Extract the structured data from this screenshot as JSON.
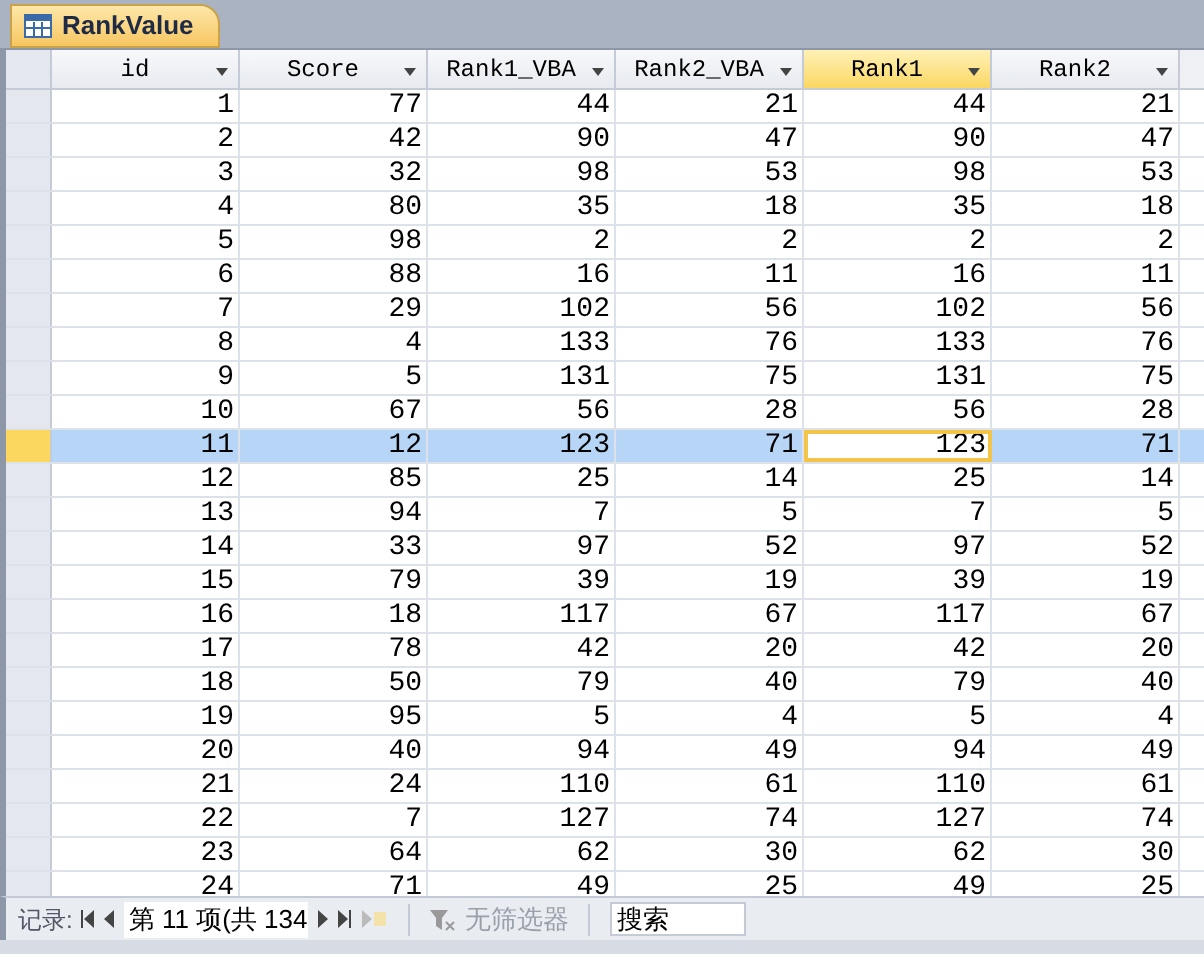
{
  "tab": {
    "title": "RankValue"
  },
  "columns": [
    {
      "label": "id",
      "selected": false
    },
    {
      "label": "Score",
      "selected": false
    },
    {
      "label": "Rank1_VBA",
      "selected": false
    },
    {
      "label": "Rank2_VBA",
      "selected": false
    },
    {
      "label": "Rank1",
      "selected": true
    },
    {
      "label": "Rank2",
      "selected": false
    }
  ],
  "rows": [
    {
      "cells": [
        "1",
        "77",
        "44",
        "21",
        "44",
        "21"
      ],
      "selected": false
    },
    {
      "cells": [
        "2",
        "42",
        "90",
        "47",
        "90",
        "47"
      ],
      "selected": false
    },
    {
      "cells": [
        "3",
        "32",
        "98",
        "53",
        "98",
        "53"
      ],
      "selected": false
    },
    {
      "cells": [
        "4",
        "80",
        "35",
        "18",
        "35",
        "18"
      ],
      "selected": false
    },
    {
      "cells": [
        "5",
        "98",
        "2",
        "2",
        "2",
        "2"
      ],
      "selected": false
    },
    {
      "cells": [
        "6",
        "88",
        "16",
        "11",
        "16",
        "11"
      ],
      "selected": false
    },
    {
      "cells": [
        "7",
        "29",
        "102",
        "56",
        "102",
        "56"
      ],
      "selected": false
    },
    {
      "cells": [
        "8",
        "4",
        "133",
        "76",
        "133",
        "76"
      ],
      "selected": false
    },
    {
      "cells": [
        "9",
        "5",
        "131",
        "75",
        "131",
        "75"
      ],
      "selected": false
    },
    {
      "cells": [
        "10",
        "67",
        "56",
        "28",
        "56",
        "28"
      ],
      "selected": false
    },
    {
      "cells": [
        "11",
        "12",
        "123",
        "71",
        "123",
        "71"
      ],
      "selected": true
    },
    {
      "cells": [
        "12",
        "85",
        "25",
        "14",
        "25",
        "14"
      ],
      "selected": false
    },
    {
      "cells": [
        "13",
        "94",
        "7",
        "5",
        "7",
        "5"
      ],
      "selected": false
    },
    {
      "cells": [
        "14",
        "33",
        "97",
        "52",
        "97",
        "52"
      ],
      "selected": false
    },
    {
      "cells": [
        "15",
        "79",
        "39",
        "19",
        "39",
        "19"
      ],
      "selected": false
    },
    {
      "cells": [
        "16",
        "18",
        "117",
        "67",
        "117",
        "67"
      ],
      "selected": false
    },
    {
      "cells": [
        "17",
        "78",
        "42",
        "20",
        "42",
        "20"
      ],
      "selected": false
    },
    {
      "cells": [
        "18",
        "50",
        "79",
        "40",
        "79",
        "40"
      ],
      "selected": false
    },
    {
      "cells": [
        "19",
        "95",
        "5",
        "4",
        "5",
        "4"
      ],
      "selected": false
    },
    {
      "cells": [
        "20",
        "40",
        "94",
        "49",
        "94",
        "49"
      ],
      "selected": false
    },
    {
      "cells": [
        "21",
        "24",
        "110",
        "61",
        "110",
        "61"
      ],
      "selected": false
    },
    {
      "cells": [
        "22",
        "7",
        "127",
        "74",
        "127",
        "74"
      ],
      "selected": false
    },
    {
      "cells": [
        "23",
        "64",
        "62",
        "30",
        "62",
        "30"
      ],
      "selected": false
    },
    {
      "cells": [
        "24",
        "71",
        "49",
        "25",
        "49",
        "25"
      ],
      "selected": false
    }
  ],
  "navigator": {
    "label": "记录:",
    "position": "第 11 项(共 134",
    "filter": "无筛选器",
    "search_placeholder": "搜索"
  }
}
